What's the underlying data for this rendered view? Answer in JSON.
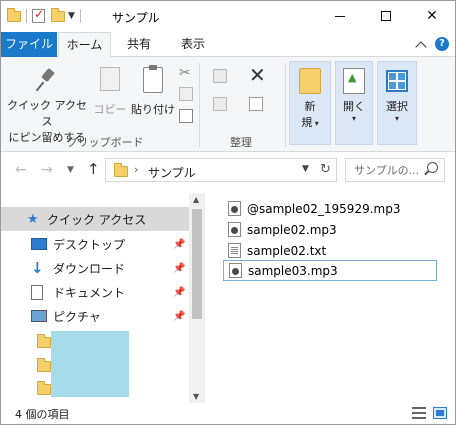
{
  "window": {
    "title": "サンプル",
    "minimize_glyph": "—",
    "close_glyph": "✕"
  },
  "ribbon": {
    "tabs": [
      "ファイル",
      "ホーム",
      "共有",
      "表示"
    ],
    "active_tab": "ホーム",
    "clipboard": {
      "pin_label_1": "クイック アクセス",
      "pin_label_2": "にピン留めする",
      "copy_label": "コピー",
      "paste_label": "貼り付け",
      "group_label": "クリップボード"
    },
    "organize": {
      "group_label": "整理"
    },
    "new": {
      "label_1": "新",
      "label_2": "規"
    },
    "open": {
      "label": "開く"
    },
    "select": {
      "label": "選択"
    },
    "help_glyph": "?"
  },
  "address": {
    "path": "サンプル",
    "search_placeholder": "サンプルの..."
  },
  "nav_pane": {
    "quick_access": "クイック アクセス",
    "items": [
      {
        "label": "デスクトップ",
        "icon": "desktop-icon"
      },
      {
        "label": "ダウンロード",
        "icon": "download-icon"
      },
      {
        "label": "ドキュメント",
        "icon": "documents-icon"
      },
      {
        "label": "ピクチャ",
        "icon": "pictures-icon"
      }
    ]
  },
  "files": [
    {
      "name": "@sample02_195929.mp3",
      "type": "mp3",
      "selected": false
    },
    {
      "name": "sample02.mp3",
      "type": "mp3",
      "selected": false
    },
    {
      "name": "sample02.txt",
      "type": "txt",
      "selected": false
    },
    {
      "name": "sample03.mp3",
      "type": "mp3",
      "selected": true
    }
  ],
  "status": {
    "item_count": "4 個の項目"
  },
  "colors": {
    "file_tab": "#1979ca",
    "selection_border": "#7ab0e0",
    "ribbon_bg": "#f5f6f7",
    "accent_blue": "#2f7dd1",
    "cyan_block": "#a6dcea"
  }
}
